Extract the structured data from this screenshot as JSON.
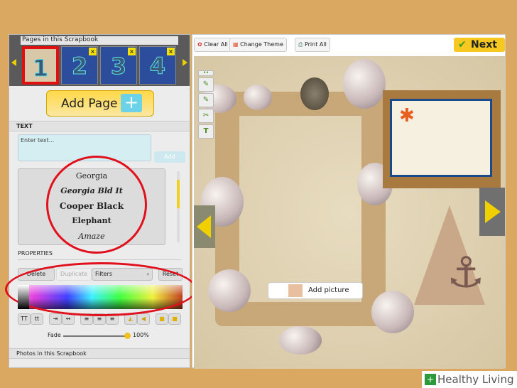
{
  "pages_panel": {
    "title": "Pages in this Scrapbook",
    "pages": [
      "1",
      "2",
      "3",
      "4"
    ],
    "delete_glyph": "×"
  },
  "add_page": {
    "label": "Add Page"
  },
  "text_section": {
    "title": "TEXT",
    "placeholder": "Enter text...",
    "add_label": "Add",
    "fonts": [
      "Georgia",
      "Georgia Bld It",
      "Cooper Black",
      "Elephant",
      "Amaze"
    ]
  },
  "properties": {
    "title": "PROPERTIES",
    "delete": "Delete",
    "duplicate": "Duplicate",
    "filters": "Filters",
    "reset": "Reset",
    "fade_label": "Fade",
    "fade_value": "100%",
    "fade_percent": 100
  },
  "photos_section": {
    "title": "Photos in this Scrapbook"
  },
  "toolbar": {
    "clear_all": "Clear All",
    "change_theme": "Change Theme",
    "print_all": "Print All",
    "next": "Next"
  },
  "canvas": {
    "add_picture": "Add picture"
  },
  "watermark": {
    "text": "Healthy Living"
  },
  "colors": {
    "highlight_ring": "#e0101c",
    "accent": "#f6c820",
    "selected_page": "#e01010"
  }
}
